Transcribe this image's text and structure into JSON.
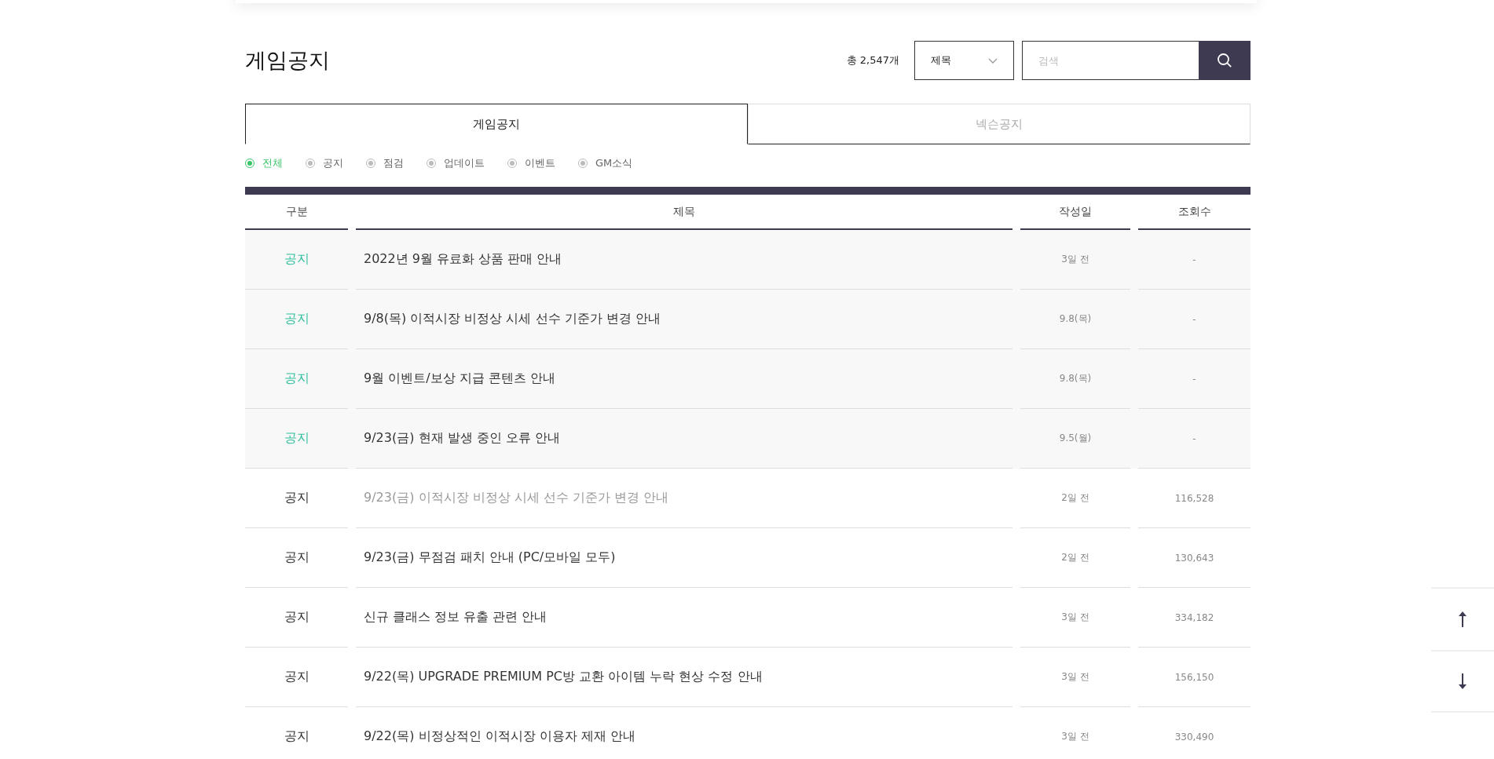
{
  "page_title": "게임공지",
  "total_count": "총 2,547개",
  "search": {
    "field_select": "제목",
    "placeholder": "검색"
  },
  "tabs": [
    {
      "label": "게임공지",
      "selected": true
    },
    {
      "label": "넥슨공지",
      "selected": false
    }
  ],
  "filters": [
    {
      "label": "전체",
      "selected": true
    },
    {
      "label": "공지",
      "selected": false
    },
    {
      "label": "점검",
      "selected": false
    },
    {
      "label": "업데이트",
      "selected": false
    },
    {
      "label": "이벤트",
      "selected": false
    },
    {
      "label": "GM소식",
      "selected": false
    }
  ],
  "table": {
    "columns": [
      "구분",
      "제목",
      "작성일",
      "조회수"
    ],
    "rows": [
      {
        "category": "공지",
        "title": "2022년 9월 유료화 상품 판매 안내",
        "date": "3일 전",
        "views": "-",
        "pinned": true,
        "visited": false
      },
      {
        "category": "공지",
        "title": "9/8(목) 이적시장 비정상 시세 선수 기준가 변경 안내",
        "date": "9.8(목)",
        "views": "-",
        "pinned": true,
        "visited": false
      },
      {
        "category": "공지",
        "title": "9월 이벤트/보상 지급 콘텐츠 안내",
        "date": "9.8(목)",
        "views": "-",
        "pinned": true,
        "visited": false
      },
      {
        "category": "공지",
        "title": "9/23(금) 현재 발생 중인 오류 안내",
        "date": "9.5(월)",
        "views": "-",
        "pinned": true,
        "visited": false
      },
      {
        "category": "공지",
        "title": "9/23(금) 이적시장 비정상 시세 선수 기준가 변경 안내",
        "date": "2일 전",
        "views": "116,528",
        "pinned": false,
        "visited": true
      },
      {
        "category": "공지",
        "title": "9/23(금) 무점검 패치 안내 (PC/모바일 모두)",
        "date": "2일 전",
        "views": "130,643",
        "pinned": false,
        "visited": false
      },
      {
        "category": "공지",
        "title": "신규 클래스 정보 유출 관련 안내",
        "date": "3일 전",
        "views": "334,182",
        "pinned": false,
        "visited": false
      },
      {
        "category": "공지",
        "title": "9/22(목) UPGRADE PREMIUM PC방 교환 아이템 누락 현상 수정 안내",
        "date": "3일 전",
        "views": "156,150",
        "pinned": false,
        "visited": false
      },
      {
        "category": "공지",
        "title": "9/22(목) 비정상적인 이적시장 이용자 제재 안내",
        "date": "3일 전",
        "views": "330,490",
        "pinned": false,
        "visited": false
      }
    ]
  }
}
